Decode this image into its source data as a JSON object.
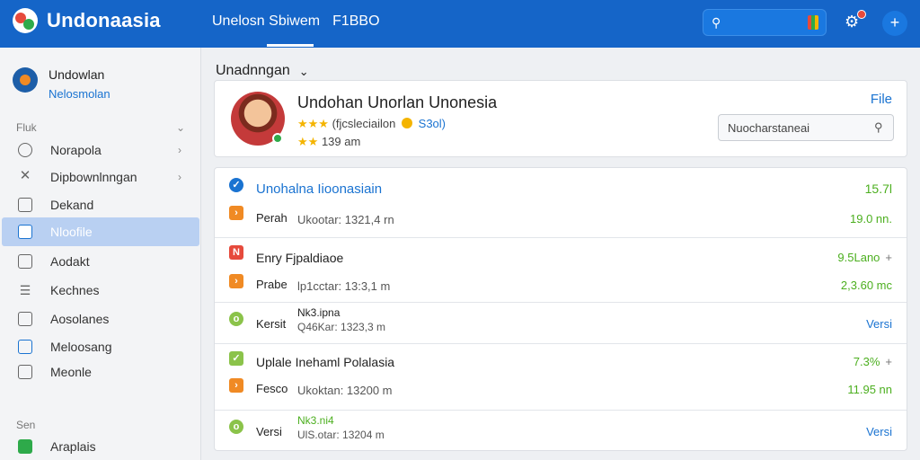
{
  "app": {
    "title": "Undonaasia"
  },
  "topnav": {
    "items": [
      "Unelosn Sbiwem",
      "F1BBO"
    ]
  },
  "sidebar": {
    "profile_name": "Undowlan",
    "profile_sub": "Nelosmolan",
    "section1_label": "Fluk",
    "items": [
      {
        "label": "Norapola",
        "icon": "pin-icon",
        "chevron": true
      },
      {
        "label": "Dipbownlnngan",
        "icon": "tools-icon",
        "chevron": true
      },
      {
        "label": "Dekand",
        "icon": "calendar-icon",
        "chevron": false
      },
      {
        "label": "Nloofile",
        "icon": "file-icon",
        "chevron": false,
        "active": true
      },
      {
        "label": "Aodakt",
        "icon": "edit-icon",
        "chevron": false
      },
      {
        "label": "Kechnes",
        "icon": "list-icon",
        "chevron": false
      },
      {
        "label": "Aosolanes",
        "icon": "document-icon",
        "chevron": false
      },
      {
        "label": "Meloosang",
        "icon": "image-icon",
        "chevron": false
      },
      {
        "label": "Meonle",
        "icon": "grid-icon",
        "chevron": false
      }
    ],
    "section2_label": "Sen",
    "app_item": "Araplais"
  },
  "main": {
    "heading": "Unadnngan",
    "profile": {
      "title": "Undohan Unorlan Unonesia",
      "line1_rating": "★★★",
      "line1_text": "(fjcsleciailon",
      "line1_link": "S3ol)",
      "line2_rating": "★★",
      "line2_text": "139 am",
      "file_label": "File",
      "input_value": "Nuocharstaneai"
    },
    "groups": [
      {
        "head": {
          "label": "Unohalna Iioonasiain",
          "value": "15.7l"
        },
        "rows": [
          {
            "label": "Perah",
            "meta": "Ukootar: 1321,4 rn",
            "value": "19.0 nn."
          }
        ]
      },
      {
        "head": {
          "label": "Enry Fjpaldiaoe",
          "value": "9.5Lano"
        },
        "rows": [
          {
            "label": "Prabe",
            "meta": "lp1cctar: 13:3,1 m",
            "value": "2,3.60 mc"
          }
        ]
      },
      {
        "head": {
          "label": "Kersit",
          "meta_top": "Nk3.ipna",
          "meta": "Q46Kar: 1323,3 m",
          "value": "Versi"
        },
        "rows": []
      },
      {
        "head": {
          "label": "Uplale Inehaml Polalasia",
          "value": "7.3%"
        },
        "rows": [
          {
            "label": "Fesco",
            "meta": "Ukoktan: 13200 m",
            "value": "11.95 nn"
          }
        ]
      },
      {
        "head": {
          "label": "Versi",
          "meta_top": "Nk3.ni4",
          "meta": "UlS.otar: 13204 m",
          "value": "Versi"
        },
        "rows": []
      }
    ]
  },
  "colors": {
    "topbar": "#1565c8",
    "accent": "#1a73d1",
    "green": "#4caf1f",
    "orange": "#f08a24",
    "red": "#e64a3c"
  }
}
